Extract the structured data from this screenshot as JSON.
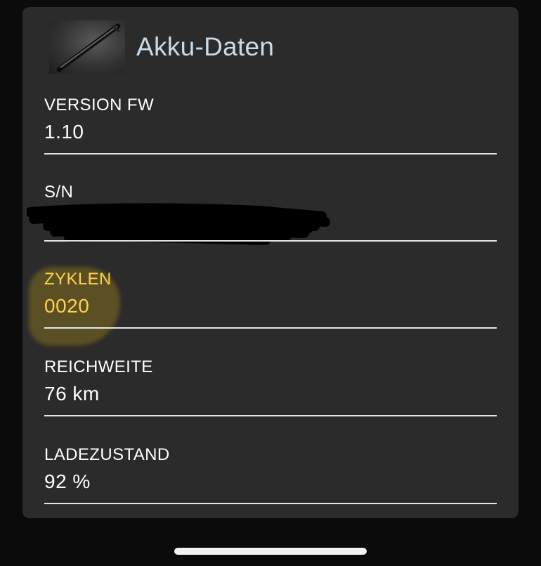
{
  "header": {
    "title": "Akku-Daten",
    "thumbnail_icon": "scooter-image"
  },
  "fields": [
    {
      "label": "VERSION FW",
      "value": "1.10"
    },
    {
      "label": "S/N",
      "value": "",
      "redacted": true
    },
    {
      "label": "ZYKLEN",
      "value": "0020",
      "highlighted": true
    },
    {
      "label": "REICHWEITE",
      "value": "76 km"
    },
    {
      "label": "LADEZUSTAND",
      "value": "92 %"
    }
  ],
  "colors": {
    "background": "#0b0b0b",
    "card": "#2b2b2b",
    "title": "#c9dbe6",
    "text": "#ffffff",
    "highlight": "#ffd24d"
  }
}
